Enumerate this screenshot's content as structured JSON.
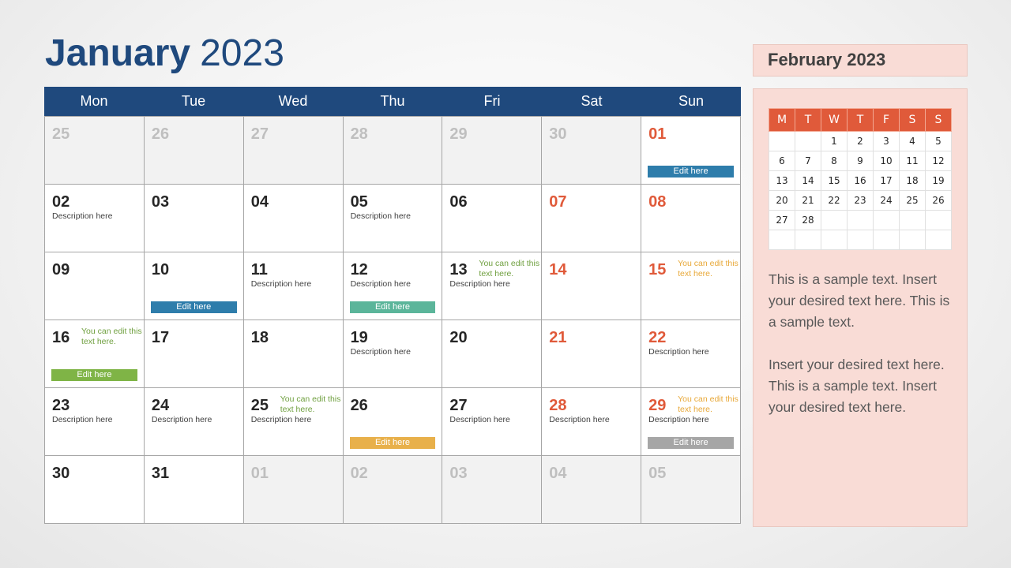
{
  "title": {
    "month": "January",
    "year": "2023"
  },
  "weekdays": [
    "Mon",
    "Tue",
    "Wed",
    "Thu",
    "Fri",
    "Sat",
    "Sun"
  ],
  "colors": {
    "header_blue": "#1f497d",
    "weekend_red": "#e05a3a",
    "btn_blue": "#2e7dab",
    "btn_teal": "#5bb59a",
    "btn_green": "#7fb446",
    "btn_yellow": "#e8b04a",
    "btn_gray": "#a6a6a6",
    "panel_pink": "#f9dcd6"
  },
  "weeks": [
    [
      {
        "n": "25",
        "o": 1
      },
      {
        "n": "26",
        "o": 1
      },
      {
        "n": "27",
        "o": 1
      },
      {
        "n": "28",
        "o": 1
      },
      {
        "n": "29",
        "o": 1
      },
      {
        "n": "30",
        "o": 1
      },
      {
        "n": "01",
        "w": 1,
        "btn": "Edit here",
        "bc": "#2e7dab"
      }
    ],
    [
      {
        "n": "02",
        "d": "Description here"
      },
      {
        "n": "03"
      },
      {
        "n": "04"
      },
      {
        "n": "05",
        "d": "Description here"
      },
      {
        "n": "06"
      },
      {
        "n": "07",
        "w": 1
      },
      {
        "n": "08",
        "w": 1
      }
    ],
    [
      {
        "n": "09"
      },
      {
        "n": "10",
        "btn": "Edit here",
        "bc": "#2e7dab"
      },
      {
        "n": "11",
        "d": "Description here"
      },
      {
        "n": "12",
        "d": "Description here",
        "btn": "Edit here",
        "bc": "#5bb59a"
      },
      {
        "n": "13",
        "d": "Description here",
        "note": "You can edit this text here.",
        "nc": "green"
      },
      {
        "n": "14",
        "w": 1
      },
      {
        "n": "15",
        "w": 1,
        "note": "You can edit this text here.",
        "nc": "orange"
      }
    ],
    [
      {
        "n": "16",
        "note": "You can edit this text here.",
        "nc": "green",
        "btn": "Edit here",
        "bc": "#7fb446"
      },
      {
        "n": "17"
      },
      {
        "n": "18"
      },
      {
        "n": "19",
        "d": "Description here"
      },
      {
        "n": "20"
      },
      {
        "n": "21",
        "w": 1
      },
      {
        "n": "22",
        "w": 1,
        "d": "Description here"
      }
    ],
    [
      {
        "n": "23",
        "d": "Description here"
      },
      {
        "n": "24",
        "d": "Description here"
      },
      {
        "n": "25",
        "d": "Description here",
        "note": "You can edit this text here.",
        "nc": "green"
      },
      {
        "n": "26",
        "btn": "Edit here",
        "bc": "#e8b04a"
      },
      {
        "n": "27",
        "d": "Description here"
      },
      {
        "n": "28",
        "w": 1,
        "d": "Description here"
      },
      {
        "n": "29",
        "w": 1,
        "d": "Description here",
        "note": "You can edit this text here.",
        "nc": "orange",
        "btn": "Edit here",
        "bc": "#a6a6a6"
      }
    ],
    [
      {
        "n": "30"
      },
      {
        "n": "31"
      },
      {
        "n": "01",
        "o": 1
      },
      {
        "n": "02",
        "o": 1
      },
      {
        "n": "03",
        "o": 1
      },
      {
        "n": "04",
        "o": 1
      },
      {
        "n": "05",
        "o": 1
      }
    ]
  ],
  "side": {
    "title": "February 2023",
    "mini_headers": [
      "M",
      "T",
      "W",
      "T",
      "F",
      "S",
      "S"
    ],
    "mini_rows": [
      [
        "",
        "",
        "1",
        "2",
        "3",
        "4",
        "5"
      ],
      [
        "6",
        "7",
        "8",
        "9",
        "10",
        "11",
        "12"
      ],
      [
        "13",
        "14",
        "15",
        "16",
        "17",
        "18",
        "19"
      ],
      [
        "20",
        "21",
        "22",
        "23",
        "24",
        "25",
        "26"
      ],
      [
        "27",
        "28",
        "",
        "",
        "",
        "",
        ""
      ],
      [
        "",
        "",
        "",
        "",
        "",
        "",
        ""
      ]
    ],
    "paragraphs": [
      "This is a sample text. Insert your desired text here. This is a sample text.",
      "Insert your desired text here. This is a sample text. Insert your desired text here."
    ]
  }
}
